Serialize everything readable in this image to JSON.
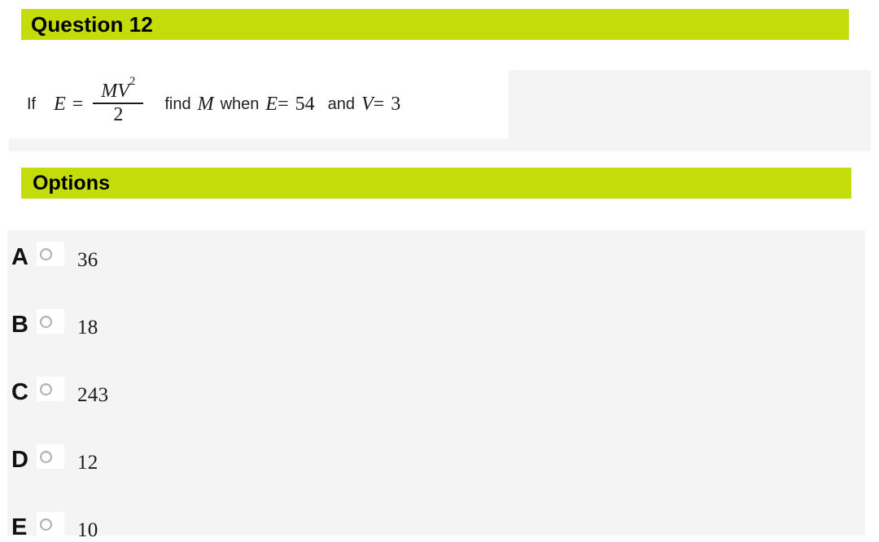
{
  "question_section": {
    "header_label": "Question 12",
    "accent_color": "#c4dc09",
    "body": {
      "prefix": "If",
      "lhs_var": "E",
      "equals": "=",
      "fraction": {
        "numerator_var1": "M",
        "numerator_var2": "V",
        "numerator_exponent": "2",
        "denominator": "2"
      },
      "find_word": "find",
      "unknown_var": "M",
      "when_word": "when",
      "given1_var": "E",
      "given1_eq": "=",
      "given1_value": "54",
      "and_word": "and",
      "given2_var": "V",
      "given2_eq": "=",
      "given2_value": "3"
    }
  },
  "options_section": {
    "header_label": "Options",
    "items": [
      {
        "letter": "A",
        "value": "36",
        "selected": false
      },
      {
        "letter": "B",
        "value": "18",
        "selected": false
      },
      {
        "letter": "C",
        "value": "243",
        "selected": false
      },
      {
        "letter": "D",
        "value": "12",
        "selected": false
      },
      {
        "letter": "E",
        "value": "10",
        "selected": false
      }
    ]
  }
}
